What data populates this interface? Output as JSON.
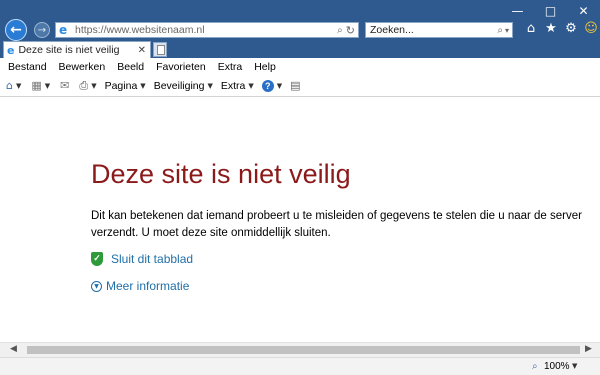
{
  "browser": {
    "address_url": "https://www.websitenaam.nl",
    "search_placeholder": "Zoeken...",
    "tab_title": "Deze site is niet veilig"
  },
  "menu": [
    "Bestand",
    "Bewerken",
    "Beeld",
    "Favorieten",
    "Extra",
    "Help"
  ],
  "commandbar": {
    "pagina": "Pagina",
    "beveiliging": "Beveiliging",
    "extra": "Extra"
  },
  "content": {
    "title": "Deze site is niet veilig",
    "body": "Dit kan betekenen dat iemand probeert u te misleiden of gegevens te stelen die u naar de server verzendt. U moet deze site onmiddellijk sluiten.",
    "close_link": "Sluit dit tabblad",
    "more_info_link": "Meer informatie"
  },
  "status": {
    "zoom": "100%"
  },
  "colors": {
    "titlebar": "#2e5a8f",
    "warning_title": "#8b1a1a",
    "link": "#1f6fa8",
    "shield": "#2e9a3a"
  }
}
